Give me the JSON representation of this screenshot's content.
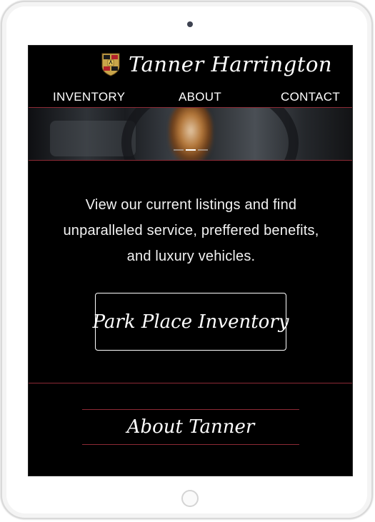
{
  "brand": {
    "name": "Tanner Harrington",
    "crest_icon": "porsche-crest-icon"
  },
  "nav": {
    "inventory": "INVENTORY",
    "about": "ABOUT",
    "contact": "CONTACT"
  },
  "hero": {
    "slide_count": 3,
    "active_slide": 2
  },
  "intro": {
    "text": "View our current listings and find unparalleled service, preffered benefits, and luxury vehicles."
  },
  "cta": {
    "label": "Park Place Inventory"
  },
  "about": {
    "heading": "About Tanner"
  },
  "colors": {
    "background": "#000000",
    "accent": "#8d2a35",
    "text": "#ffffff"
  }
}
